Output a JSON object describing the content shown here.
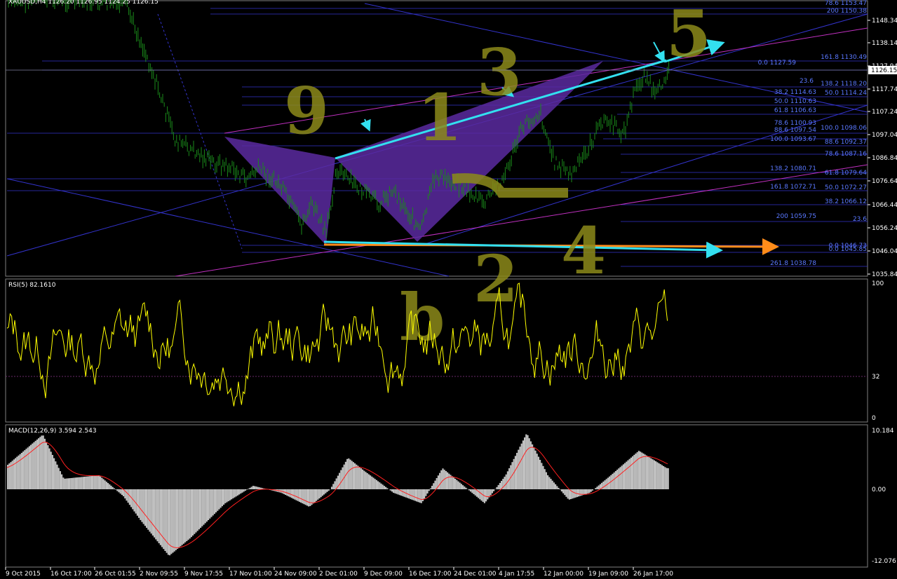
{
  "app": {
    "title": "XAUUSD,H4  1126.20 1126.95 1124.25 1126.15"
  },
  "colors": {
    "background": "#000000",
    "grid_line": "#3333cc",
    "fib_label": "#5a78ff",
    "price_bar": "#1a8a1a",
    "rsi_line": "#ffff00",
    "macd_hist": "#c0c0c0",
    "macd_signal": "#ff2020",
    "pattern_fill": "#5b2aa0",
    "arrow_cyan": "#33e0f0",
    "arrow_orange": "#ff8c1a",
    "magenta_line": "#c030c0",
    "handwriting": "#8c8a1a"
  },
  "price_axis": {
    "current_price": "1126.15",
    "ticks": [
      "1148.34",
      "1138.14",
      "1127.94",
      "1117.74",
      "1107.24",
      "1097.04",
      "1086.84",
      "1076.64",
      "1066.44",
      "1056.24",
      "1046.04",
      "1035.84"
    ]
  },
  "fib_labels": [
    {
      "text": "78.6 1153.47"
    },
    {
      "text": "200 1150.38"
    },
    {
      "text": "161.8 1130.49"
    },
    {
      "text": "0.0 1127.59"
    },
    {
      "text": "23.6"
    },
    {
      "text": "138.2 1118.20"
    },
    {
      "text": "38.2 1114.63"
    },
    {
      "text": "50.0 1114.24"
    },
    {
      "text": "50.0 1110.63"
    },
    {
      "text": "61.8 1106.63"
    },
    {
      "text": "78.6 1100.93"
    },
    {
      "text": "100.0 1098.06"
    },
    {
      "text": "88.6 1097.54"
    },
    {
      "text": "88.6 1092.37"
    },
    {
      "text": "100.0 1093.67"
    },
    {
      "text": "78.6 1087.16"
    },
    {
      "text": "138.2 1080.71"
    },
    {
      "text": "61.8 1079.64"
    },
    {
      "text": "161.8 1072.71"
    },
    {
      "text": "50.0 1072.27"
    },
    {
      "text": "38.2 1066.12"
    },
    {
      "text": "200 1059.75"
    },
    {
      "text": "23.6"
    },
    {
      "text": "0.0 1046.73"
    },
    {
      "text": "0.0 1045.85"
    },
    {
      "text": "261.8 1038.78"
    }
  ],
  "handwritten_labels": [
    "9",
    "1",
    "3",
    "5",
    "2",
    "4",
    "b"
  ],
  "rsi": {
    "header": "RSI(5) 82.1610",
    "level_labels": [
      "100",
      "32",
      "0"
    ]
  },
  "macd": {
    "header": "MACD(12,26,9) 3.594 2.543",
    "level_labels": [
      "10.184",
      "0.00",
      "-12.076"
    ]
  },
  "time_axis": {
    "ticks": [
      "9 Oct 2015",
      "16 Oct 17:00",
      "26 Oct 01:55",
      "2 Nov 09:55",
      "9 Nov 17:55",
      "17 Nov 01:00",
      "24 Nov 09:00",
      "2 Dec 01:00",
      "9 Dec 09:00",
      "16 Dec 17:00",
      "24 Dec 01:00",
      "4 Jan 17:55",
      "12 Jan 00:00",
      "19 Jan 09:00",
      "26 Jan 17:00"
    ]
  }
}
